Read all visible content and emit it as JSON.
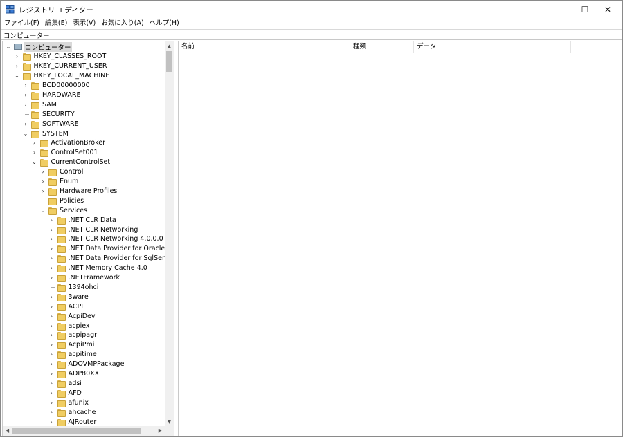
{
  "window": {
    "title": "レジストリ エディター",
    "controls": {
      "minimize": "—",
      "maximize": "☐",
      "close": "✕"
    }
  },
  "menu": [
    "ファイル(F)",
    "編集(E)",
    "表示(V)",
    "お気に入り(A)",
    "ヘルプ(H)"
  ],
  "address": "コンピューター",
  "tree": [
    {
      "label": "コンピューター",
      "depth": 0,
      "toggle": "expanded",
      "icon": "computer-icon",
      "selected": true
    },
    {
      "label": "HKEY_CLASSES_ROOT",
      "depth": 1,
      "toggle": "collapsed"
    },
    {
      "label": "HKEY_CURRENT_USER",
      "depth": 1,
      "toggle": "collapsed"
    },
    {
      "label": "HKEY_LOCAL_MACHINE",
      "depth": 1,
      "toggle": "expanded"
    },
    {
      "label": "BCD00000000",
      "depth": 2,
      "toggle": "collapsed"
    },
    {
      "label": "HARDWARE",
      "depth": 2,
      "toggle": "collapsed"
    },
    {
      "label": "SAM",
      "depth": 2,
      "toggle": "collapsed"
    },
    {
      "label": "SECURITY",
      "depth": 2,
      "toggle": "none"
    },
    {
      "label": "SOFTWARE",
      "depth": 2,
      "toggle": "collapsed"
    },
    {
      "label": "SYSTEM",
      "depth": 2,
      "toggle": "expanded"
    },
    {
      "label": "ActivationBroker",
      "depth": 3,
      "toggle": "collapsed"
    },
    {
      "label": "ControlSet001",
      "depth": 3,
      "toggle": "collapsed"
    },
    {
      "label": "CurrentControlSet",
      "depth": 3,
      "toggle": "expanded"
    },
    {
      "label": "Control",
      "depth": 4,
      "toggle": "collapsed"
    },
    {
      "label": "Enum",
      "depth": 4,
      "toggle": "collapsed"
    },
    {
      "label": "Hardware Profiles",
      "depth": 4,
      "toggle": "collapsed"
    },
    {
      "label": "Policies",
      "depth": 4,
      "toggle": "none"
    },
    {
      "label": "Services",
      "depth": 4,
      "toggle": "expanded"
    },
    {
      "label": ".NET CLR Data",
      "depth": 5,
      "toggle": "collapsed"
    },
    {
      "label": ".NET CLR Networking",
      "depth": 5,
      "toggle": "collapsed"
    },
    {
      "label": ".NET CLR Networking 4.0.0.0",
      "depth": 5,
      "toggle": "collapsed"
    },
    {
      "label": ".NET Data Provider for Oracle",
      "depth": 5,
      "toggle": "collapsed"
    },
    {
      "label": ".NET Data Provider for SqlServer",
      "depth": 5,
      "toggle": "collapsed"
    },
    {
      "label": ".NET Memory Cache 4.0",
      "depth": 5,
      "toggle": "collapsed"
    },
    {
      "label": ".NETFramework",
      "depth": 5,
      "toggle": "collapsed"
    },
    {
      "label": "1394ohci",
      "depth": 5,
      "toggle": "none"
    },
    {
      "label": "3ware",
      "depth": 5,
      "toggle": "collapsed"
    },
    {
      "label": "ACPI",
      "depth": 5,
      "toggle": "collapsed"
    },
    {
      "label": "AcpiDev",
      "depth": 5,
      "toggle": "collapsed"
    },
    {
      "label": "acpiex",
      "depth": 5,
      "toggle": "collapsed"
    },
    {
      "label": "acpipagr",
      "depth": 5,
      "toggle": "collapsed"
    },
    {
      "label": "AcpiPmi",
      "depth": 5,
      "toggle": "collapsed"
    },
    {
      "label": "acpitime",
      "depth": 5,
      "toggle": "collapsed"
    },
    {
      "label": "ADOVMPPackage",
      "depth": 5,
      "toggle": "collapsed"
    },
    {
      "label": "ADP80XX",
      "depth": 5,
      "toggle": "collapsed"
    },
    {
      "label": "adsi",
      "depth": 5,
      "toggle": "collapsed"
    },
    {
      "label": "AFD",
      "depth": 5,
      "toggle": "collapsed"
    },
    {
      "label": "afunix",
      "depth": 5,
      "toggle": "collapsed"
    },
    {
      "label": "ahcache",
      "depth": 5,
      "toggle": "collapsed"
    },
    {
      "label": "AJRouter",
      "depth": 5,
      "toggle": "collapsed"
    }
  ],
  "list": {
    "columns": [
      {
        "label": "名前"
      },
      {
        "label": "種類"
      },
      {
        "label": "データ"
      }
    ]
  }
}
